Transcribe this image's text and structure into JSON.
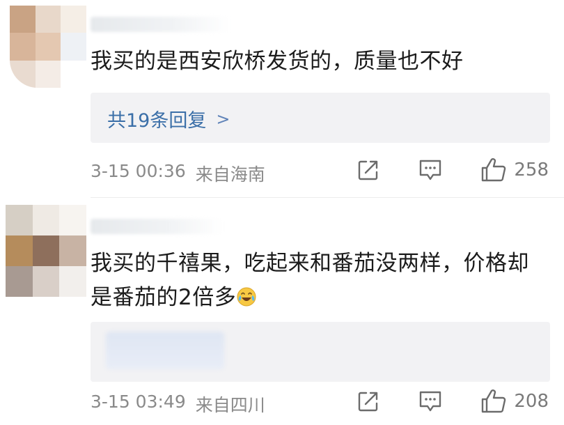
{
  "comments": [
    {
      "text": "我买的是西安欣桥发货的，质量也不好",
      "reply_summary": "共19条回复",
      "reply_chevron": ">",
      "time": "3-15 00:36",
      "location": "来自海南",
      "likes": "258",
      "avatar_colors": [
        "#c9a384",
        "#e8d8ca",
        "#f5eee6",
        "#d8b59a",
        "#e4c8b1",
        "#eef1f5",
        "#e9dbd0",
        "#f4ece6",
        "#ffffff"
      ]
    },
    {
      "text": "我买的千禧果，吃起来和番茄没两样，价格却是番茄的2倍多",
      "time": "3-15 03:49",
      "location": "来自四川",
      "likes": "208",
      "avatar_colors": [
        "#d6cfc5",
        "#efeae4",
        "#f7f4f0",
        "#b58c5c",
        "#8e6f5c",
        "#c8b3a4",
        "#a89a92",
        "#d9cfc8",
        "#f2efec"
      ]
    }
  ],
  "icons": {
    "share": "share-icon",
    "comment": "comment-icon",
    "like": "thumbs-up-icon",
    "emoji": "laughing-crying-emoji-icon"
  },
  "colors": {
    "link": "#3b6fa8",
    "meta": "#8a8a8a",
    "reply_bg": "#f2f2f4"
  }
}
